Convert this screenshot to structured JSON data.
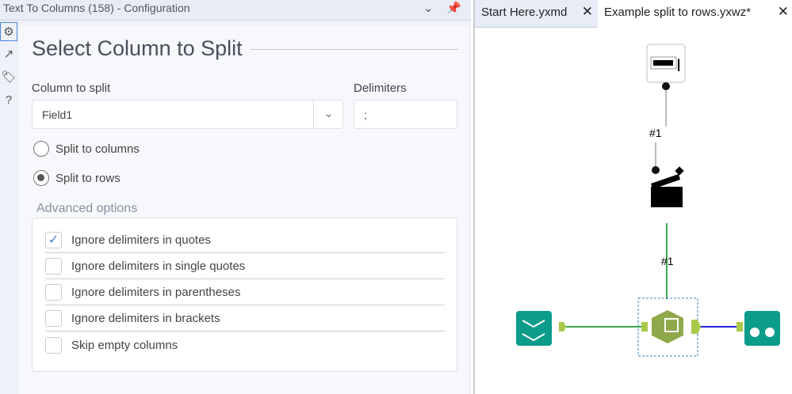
{
  "config": {
    "title": "Text To Columns (158) - Configuration",
    "heading": "Select Column to Split",
    "column_label": "Column to split",
    "column_value": "Field1",
    "delimiters_label": "Delimiters",
    "delimiters_value": ";",
    "radios": [
      {
        "label": "Split to columns",
        "selected": false
      },
      {
        "label": "Split to rows",
        "selected": true
      }
    ],
    "advanced_title": "Advanced options",
    "options": [
      {
        "label": "Ignore delimiters in quotes",
        "checked": true
      },
      {
        "label": "Ignore delimiters in single quotes",
        "checked": false
      },
      {
        "label": "Ignore delimiters in parentheses",
        "checked": false
      },
      {
        "label": "Ignore delimiters in brackets",
        "checked": false
      },
      {
        "label": "Skip empty columns",
        "checked": false
      }
    ],
    "check_glyph": "✓"
  },
  "tabs": [
    {
      "label": "Start Here.yxmd",
      "active": false
    },
    {
      "label": "Example split to rows.yxwz*",
      "active": true
    }
  ],
  "canvas": {
    "conn1": "#1",
    "conn2": "#1"
  },
  "colors": {
    "accent": "#4a88d6",
    "tool_teal": "#0b9c8a",
    "tool_olive": "#8fa84a"
  }
}
